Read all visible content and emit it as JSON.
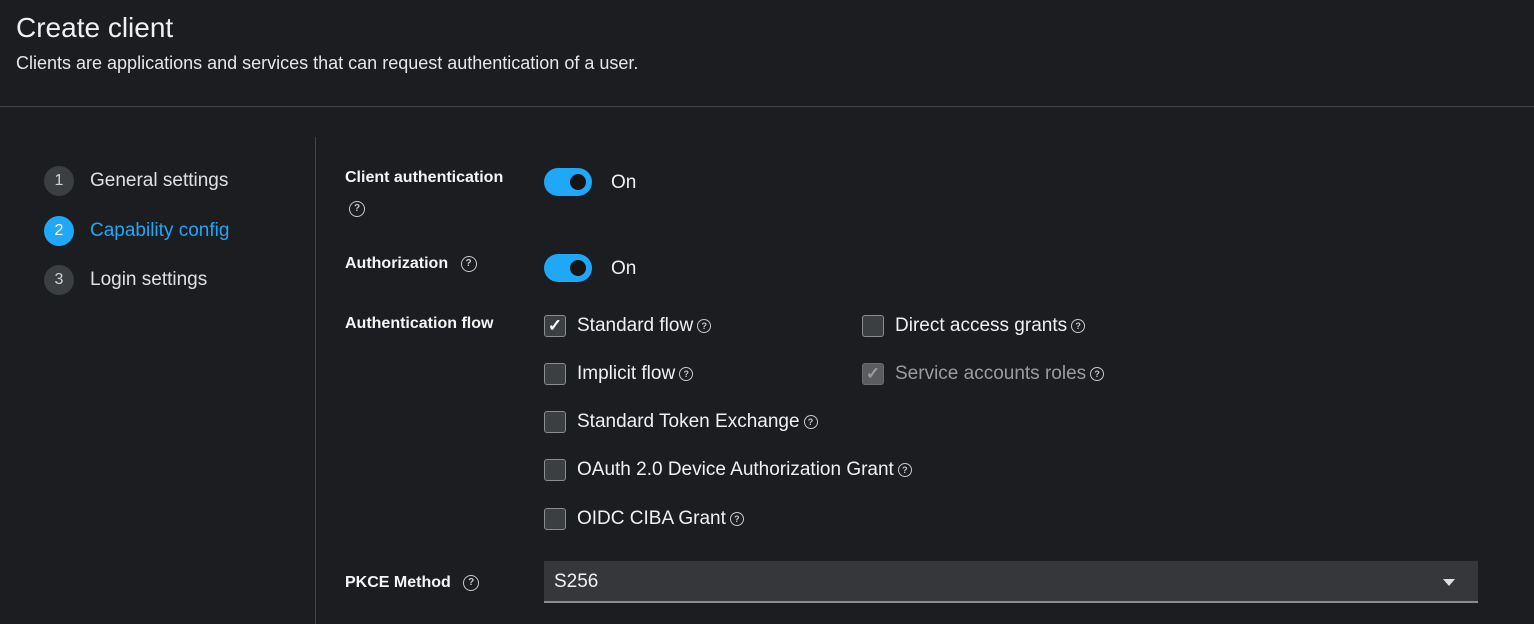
{
  "header": {
    "title": "Create client",
    "subtitle": "Clients are applications and services that can request authentication of a user."
  },
  "wizard": {
    "steps": [
      {
        "number": "1",
        "label": "General settings",
        "current": false
      },
      {
        "number": "2",
        "label": "Capability config",
        "current": true
      },
      {
        "number": "3",
        "label": "Login settings",
        "current": false
      }
    ]
  },
  "form": {
    "client_authentication": {
      "label": "Client authentication",
      "state": "On",
      "enabled": true
    },
    "authorization": {
      "label": "Authorization",
      "state": "On",
      "enabled": true
    },
    "authentication_flow": {
      "label": "Authentication flow",
      "options": [
        {
          "label": "Standard flow",
          "checked": true,
          "disabled": false
        },
        {
          "label": "Direct access grants",
          "checked": false,
          "disabled": false
        },
        {
          "label": "Implicit flow",
          "checked": false,
          "disabled": false
        },
        {
          "label": "Service accounts roles",
          "checked": true,
          "disabled": true
        },
        {
          "label": "Standard Token Exchange",
          "checked": false,
          "disabled": false
        },
        {
          "label": "OAuth 2.0 Device Authorization Grant",
          "checked": false,
          "disabled": false
        },
        {
          "label": "OIDC CIBA Grant",
          "checked": false,
          "disabled": false
        }
      ]
    },
    "pkce_method": {
      "label": "PKCE Method",
      "value": "S256"
    }
  },
  "icons": {
    "help": "help-circle-icon",
    "check": "checkmark-icon",
    "caret": "caret-down-icon"
  },
  "colors": {
    "background": "#1b1d21",
    "accent": "#1fa7f8",
    "divider": "#444548"
  }
}
